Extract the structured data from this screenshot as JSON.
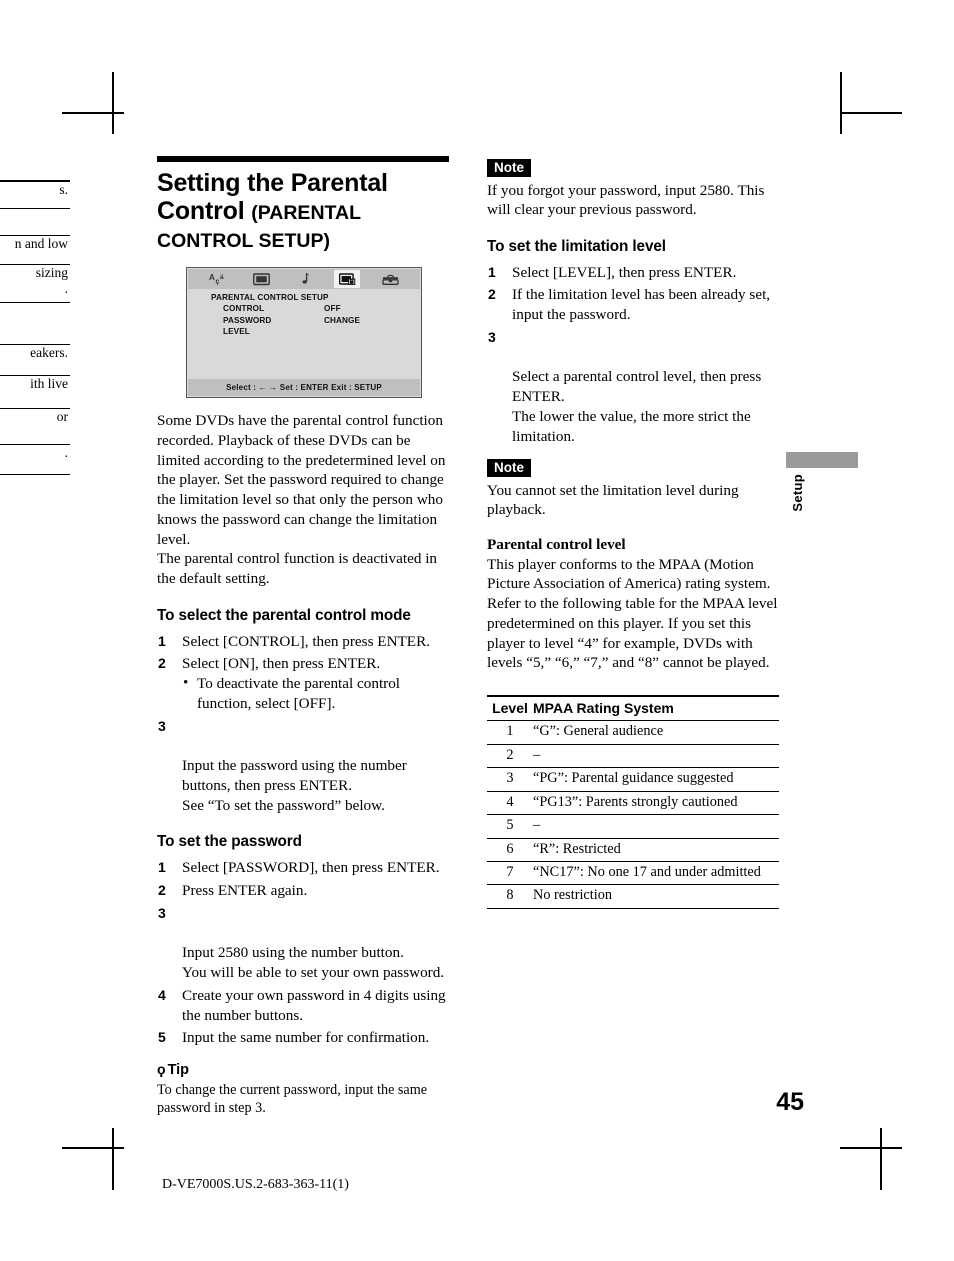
{
  "page": {
    "number": "45",
    "footer_code": "D-VE7000S.US.2-683-363-11(1)",
    "side_tab": "Setup"
  },
  "left_bleed": {
    "rows": [
      "",
      "s.",
      "",
      "n and low",
      "sizing\n.",
      "",
      "eakers.",
      "ith live",
      " or",
      "."
    ]
  },
  "article": {
    "title_line1": "Setting the Parental",
    "title_line2": "Control",
    "title_sub1": "(PARENTAL",
    "title_sub2": "CONTROL SETUP)"
  },
  "osd": {
    "icons": [
      "language-icon",
      "screen-icon",
      "audio-note-icon",
      "parental-lock-icon",
      "toolbox-icon"
    ],
    "active_icon_index": 3,
    "title": "PARENTAL CONTROL SETUP",
    "rows": [
      {
        "label": "CONTROL",
        "value": "OFF"
      },
      {
        "label": "PASSWORD",
        "value": "CHANGE"
      },
      {
        "label": "LEVEL",
        "value": ""
      }
    ],
    "footer": "Select : ←  →   Set : ENTER  Exit : SETUP"
  },
  "intro": {
    "paragraph1": "Some DVDs have the parental control function recorded. Playback of these DVDs can be limited according to the predetermined level on the player. Set the password required to change the limitation level so that only the person who knows the password can change the limitation level.",
    "paragraph2": "The parental control function is deactivated in the default setting."
  },
  "section_mode": {
    "heading": "To select the parental control mode",
    "steps": [
      {
        "num": "1",
        "text": "Select [CONTROL], then press ENTER."
      },
      {
        "num": "2",
        "text": "Select [ON], then press ENTER.",
        "bullet": "To deactivate the parental control function, select [OFF]."
      },
      {
        "num": "3",
        "text": "Input the password using the number buttons, then press ENTER.\nSee “To set the password” below."
      }
    ]
  },
  "section_password": {
    "heading": "To set the password",
    "steps": [
      {
        "num": "1",
        "text": "Select [PASSWORD], then press ENTER."
      },
      {
        "num": "2",
        "text": "Press ENTER again."
      },
      {
        "num": "3",
        "text": "Input 2580 using the number button.\nYou will be able to set your own password."
      },
      {
        "num": "4",
        "text": "Create your own password in 4 digits using the number buttons."
      },
      {
        "num": "5",
        "text": "Input the same number for confirmation."
      }
    ]
  },
  "tip": {
    "bulb": "ϙ",
    "label": "Tip",
    "text": "To change the current password, input the same password in step 3."
  },
  "note_top": {
    "badge": "Note",
    "text": "If you forgot your password, input 2580. This will clear your previous password."
  },
  "section_limitation": {
    "heading": "To set the limitation level",
    "steps": [
      {
        "num": "1",
        "text": "Select [LEVEL], then press ENTER."
      },
      {
        "num": "2",
        "text": "If the limitation level has been already set, input the password."
      },
      {
        "num": "3",
        "text": "Select a parental control level, then press ENTER.\nThe lower the value, the more strict the limitation."
      }
    ]
  },
  "note_bottom": {
    "badge": "Note",
    "text": "You cannot set the limitation level during playback."
  },
  "pcl": {
    "heading": "Parental control level",
    "text": "This player conforms to the MPAA (Motion Picture Association of America) rating system. Refer to the following table for the MPAA level predetermined on this player. If you set this player to level “4” for example, DVDs with levels “5,” “6,” “7,” and “8” cannot be played."
  },
  "mpaa_table": {
    "headers": [
      "Level",
      "MPAA Rating System"
    ],
    "rows": [
      [
        "1",
        "“G”: General audience"
      ],
      [
        "2",
        "–"
      ],
      [
        "3",
        "“PG”: Parental guidance suggested"
      ],
      [
        "4",
        "“PG13”: Parents strongly cautioned"
      ],
      [
        "5",
        "–"
      ],
      [
        "6",
        "“R”: Restricted"
      ],
      [
        "7",
        "“NC17”: No one 17 and under admitted"
      ],
      [
        "8",
        "No restriction"
      ]
    ]
  }
}
